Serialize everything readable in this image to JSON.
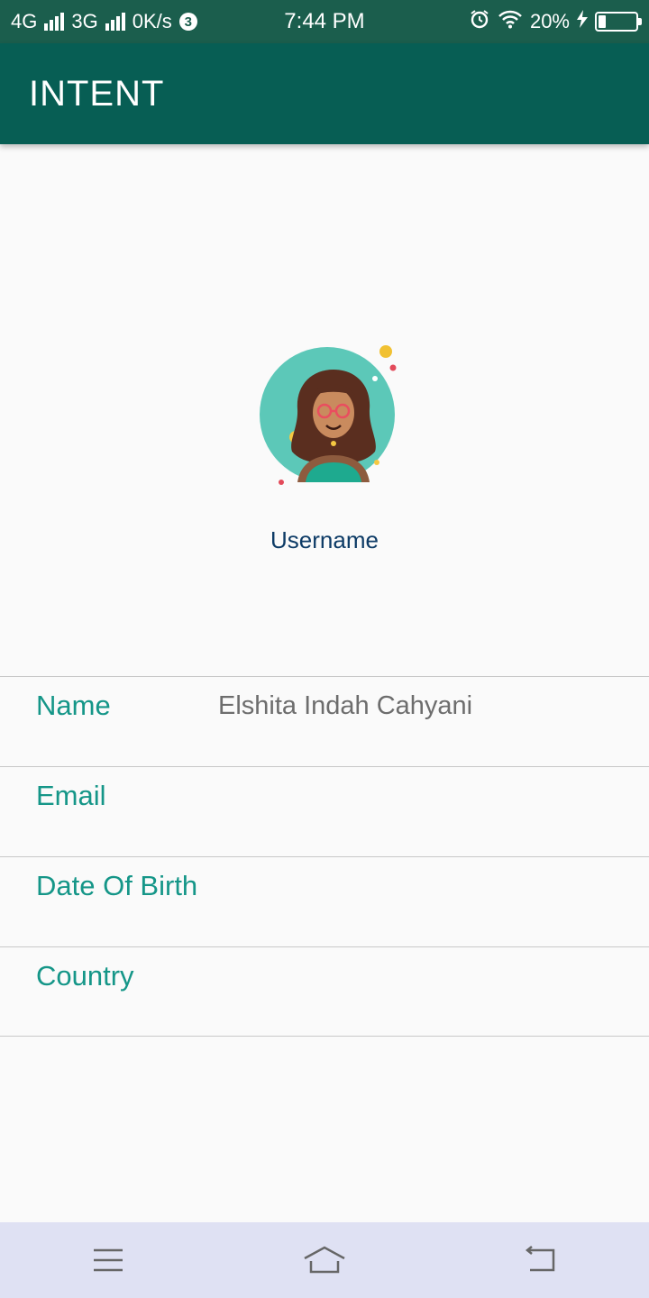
{
  "status_bar": {
    "network1": "4G",
    "network2": "3G",
    "speed": "0K/s",
    "notif_count": "3",
    "time": "7:44 PM",
    "battery": "20%"
  },
  "app_bar": {
    "title": "INTENT"
  },
  "profile": {
    "username": "Username"
  },
  "fields": [
    {
      "label": "Name",
      "value": "Elshita Indah Cahyani"
    },
    {
      "label": "Email",
      "value": ""
    },
    {
      "label": "Date Of Birth",
      "value": ""
    },
    {
      "label": "Country",
      "value": ""
    }
  ],
  "colors": {
    "status_bar": "#1b5e4d",
    "app_bar": "#075e54",
    "label": "#159688",
    "username": "#0d3b66",
    "nav_bar": "#dfe1f3"
  },
  "icons": {
    "nav": [
      "menu-icon",
      "home-icon",
      "back-icon"
    ]
  }
}
